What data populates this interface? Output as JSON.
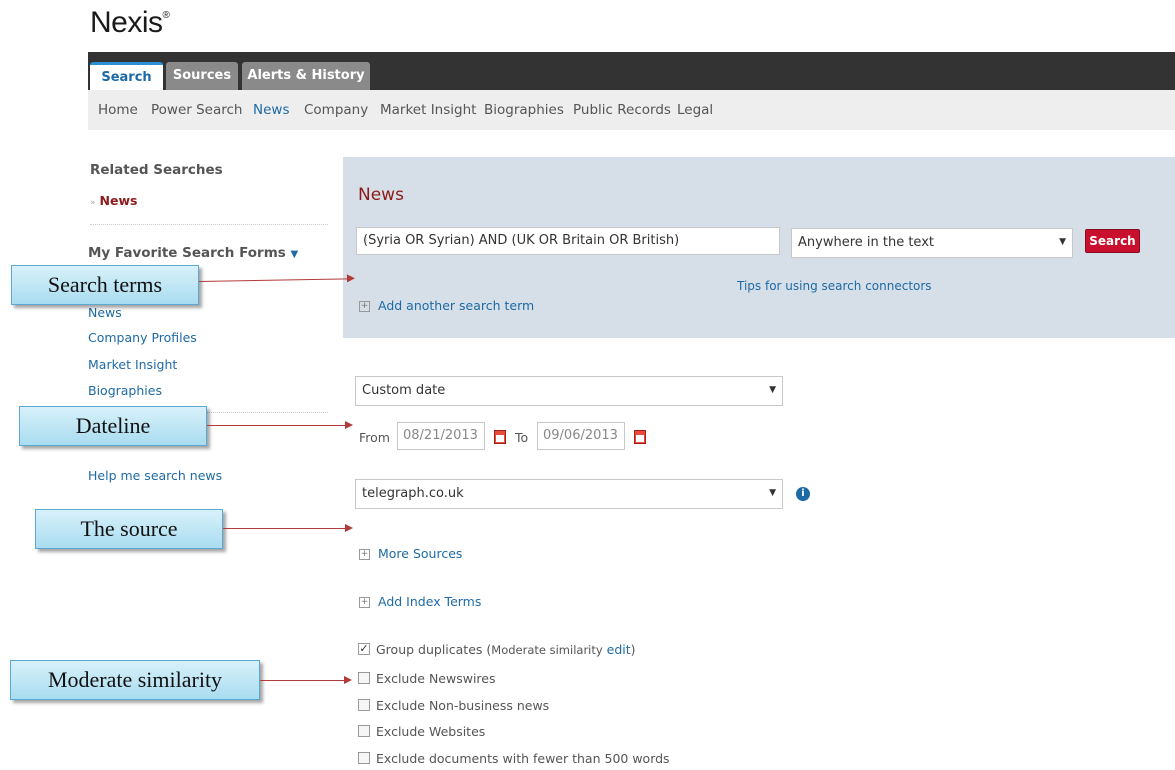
{
  "brand": {
    "logo": "Nexis",
    "logo_mark": "®"
  },
  "tabs": [
    {
      "label": "Search"
    },
    {
      "label": "Sources"
    },
    {
      "label": "Alerts & History"
    }
  ],
  "subnav": [
    "Home",
    "Power Search",
    "News",
    "Company",
    "Market Insight",
    "Biographies",
    "Public Records",
    "Legal"
  ],
  "sidebar": {
    "related_heading": "Related Searches",
    "related_item": "News",
    "favorites_heading": "My Favorite Search Forms",
    "favorites": [
      "News",
      "Company Profiles",
      "Market Insight",
      "Biographies"
    ],
    "help": "Help me search news"
  },
  "panel": {
    "title": "News",
    "search_terms": "(Syria OR Syrian) AND (UK OR Britain OR British)",
    "scope": "Anywhere in the text",
    "search_button": "Search",
    "tips_link": "Tips for using search connectors",
    "add_term": "Add another search term"
  },
  "date": {
    "selector": "Custom date",
    "from_label": "From",
    "from": "08/21/2013",
    "to_label": "To",
    "to": "09/06/2013"
  },
  "source": {
    "selector": "telegraph.co.uk",
    "more_sources": "More Sources",
    "index_terms": "Add Index Terms"
  },
  "options": {
    "group_duplicates": "Group duplicates (",
    "similarity": "Moderate similarity",
    "edit": "edit",
    "close_paren": ")",
    "checkboxes": [
      {
        "label": "Exclude Newswires",
        "checked": false
      },
      {
        "label": "Exclude Non-business news",
        "checked": false
      },
      {
        "label": "Exclude Websites",
        "checked": false
      },
      {
        "label": "Exclude documents with fewer than 500 words",
        "checked": false
      }
    ]
  },
  "callouts": [
    "Search terms",
    "Dateline",
    "The source",
    "Moderate similarity"
  ],
  "colors": {
    "accent": "#1d6aa5",
    "search_button": "#c8102e",
    "panel": "#d6dfe7",
    "title": "#8c1a1a"
  }
}
